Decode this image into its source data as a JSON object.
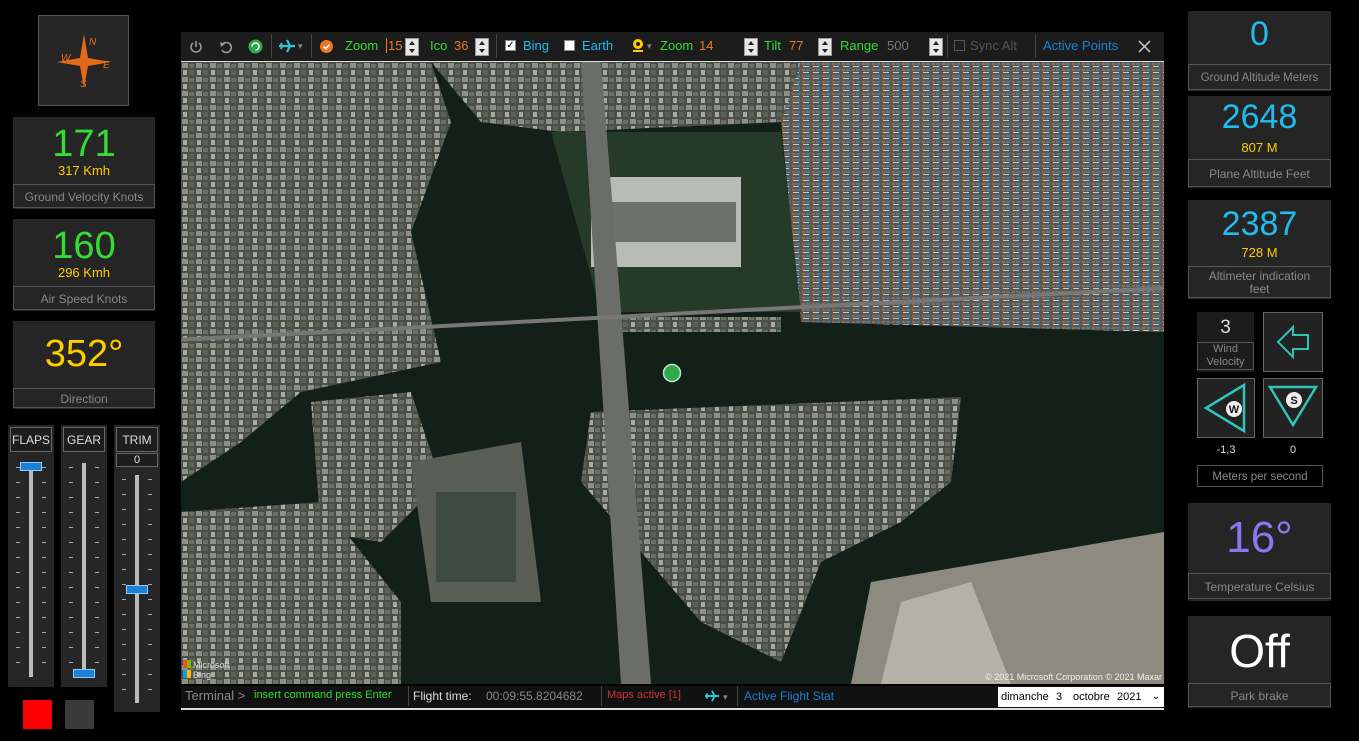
{
  "compass": {
    "n": "N",
    "s": "S",
    "e": "E",
    "w": "W"
  },
  "ground_velocity": {
    "value": "171",
    "kmh": "317 Kmh",
    "label": "Ground Velocity Knots"
  },
  "air_speed": {
    "value": "160",
    "kmh": "296 Kmh",
    "label": "Air Speed Knots"
  },
  "direction": {
    "value": "352°",
    "label": "Direction"
  },
  "sliders": {
    "flaps": {
      "label": "FLAPS",
      "level": 1.0
    },
    "gear": {
      "label": "GEAR",
      "level": 0.0
    },
    "trim": {
      "label": "TRIM",
      "value": "0",
      "level": 0.5
    }
  },
  "toolbar": {
    "zoom_label": "Zoom",
    "zoom_value": "15",
    "ico_label": "Ico",
    "ico_value": "36",
    "bing_label": "Bing",
    "bing_checked": true,
    "earth_label": "Earth",
    "earth_checked": false,
    "zoom2_label": "Zoom",
    "zoom2_value": "14",
    "tilt_label": "Tilt",
    "tilt_value": "77",
    "range_label": "Range",
    "range_value": "500",
    "sync_alt_label": "Sync Alt",
    "active_points_label": "Active Points"
  },
  "map": {
    "brand_line1": "Microsoft",
    "brand_line2": "Bing",
    "copyright": "© 2021 Microsoft Corporation © 2021 Maxar"
  },
  "status": {
    "terminal_label": "Terminal >",
    "command_placeholder": "insert command press Enter",
    "flight_time_label": "Flight time:",
    "flight_time_value": "00:09:55.8204682",
    "maps_active": "Maps active [1]",
    "active_flight_stat": "Active Flight Stat",
    "date_day": "dimanche",
    "date_num": "3",
    "date_month": "octobre",
    "date_year": "2021"
  },
  "ground_altitude": {
    "value": "0",
    "label": "Ground Altitude Meters"
  },
  "plane_altitude": {
    "value": "2648",
    "meters": "807 M",
    "label": "Plane Altitude Feet"
  },
  "altimeter": {
    "value": "2387",
    "meters": "728 M",
    "label_line1": "Altimeter indication",
    "label_line2": "feet"
  },
  "wind": {
    "velocity_value": "3",
    "velocity_label_line1": "Wind",
    "velocity_label_line2": "Velocity",
    "w_letter": "W",
    "s_letter": "S",
    "w_value": "-1,3",
    "s_value": "0",
    "unit_label": "Meters per second"
  },
  "temperature": {
    "value": "16°",
    "label": "Temperature Celsius"
  },
  "park_brake": {
    "value": "Off",
    "label": "Park brake"
  },
  "colors": {
    "green": "#33dd33",
    "yellow": "#ffcc00",
    "cyan": "#22bbee",
    "teal": "#2ec4b6",
    "purple": "#8877ee",
    "orange": "#ee7722",
    "red": "#ff0000"
  }
}
